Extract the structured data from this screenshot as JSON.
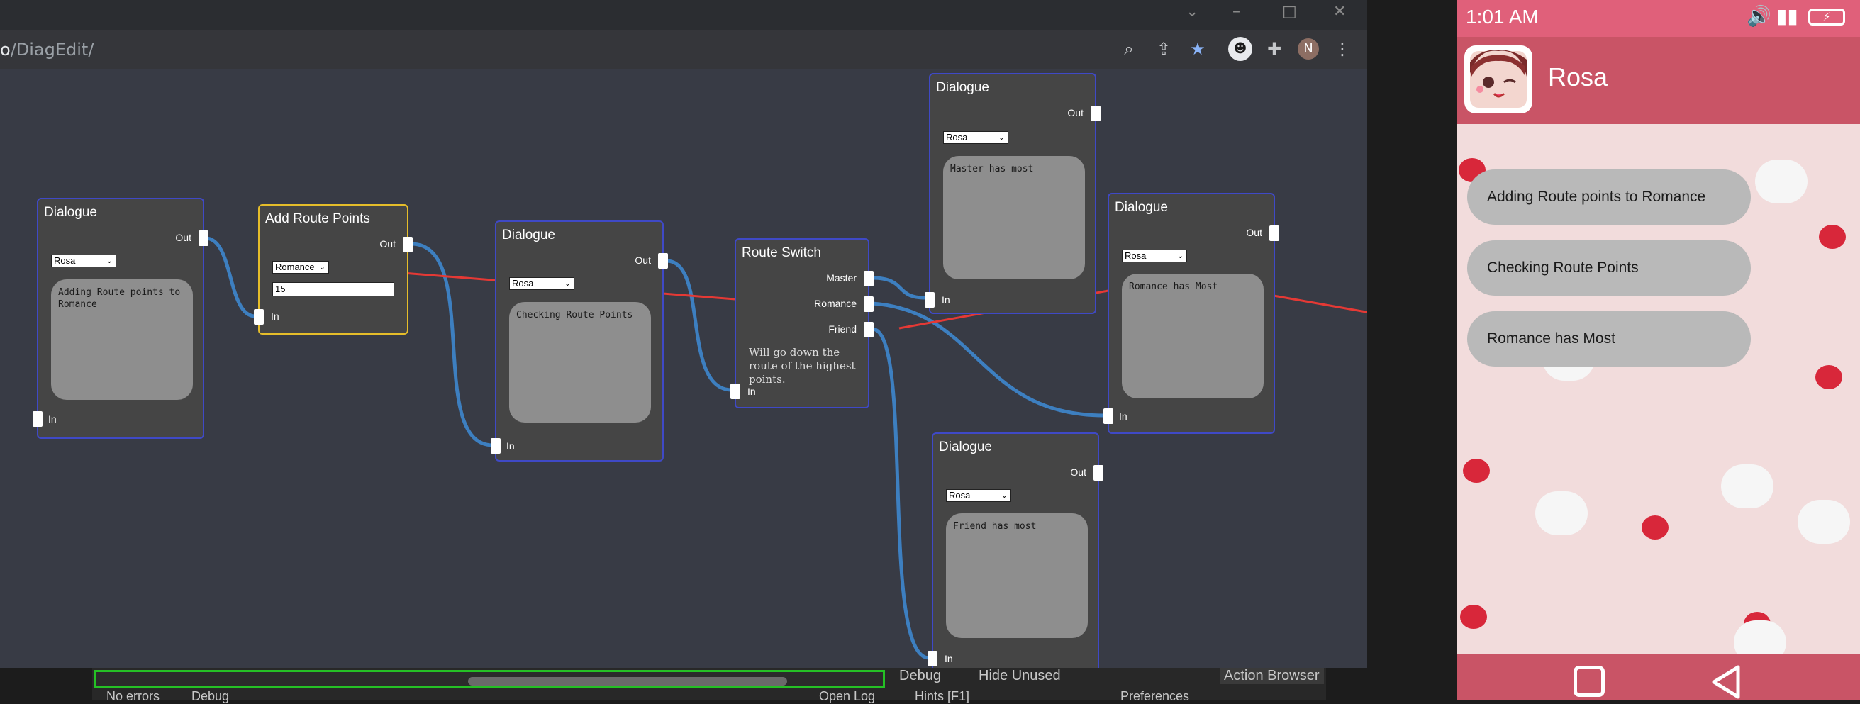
{
  "browser": {
    "url_prefix": "o",
    "url_path": "/DiagEdit/"
  },
  "graph": {
    "nodes": {
      "dialogue1": {
        "title": "Dialogue",
        "out": "Out",
        "in": "In",
        "speaker": "Rosa",
        "text": "Adding Route points to Romance"
      },
      "route_points": {
        "title": "Add Route Points",
        "out": "Out",
        "in": "In",
        "route": "Romance",
        "points": "15"
      },
      "dialogue2": {
        "title": "Dialogue",
        "out": "Out",
        "in": "In",
        "speaker": "Rosa",
        "text": "Checking Route Points"
      },
      "route_switch": {
        "title": "Route Switch",
        "master": "Master",
        "romance": "Romance",
        "friend": "Friend",
        "in": "In",
        "note": "Will go down the route of the highest points."
      },
      "dialogue_master": {
        "title": "Dialogue",
        "out": "Out",
        "in": "In",
        "speaker": "Rosa",
        "text": "Master has most"
      },
      "dialogue_romance": {
        "title": "Dialogue",
        "out": "Out",
        "in": "In",
        "speaker": "Rosa",
        "text": "Romance has Most"
      },
      "dialogue_friend": {
        "title": "Dialogue",
        "out": "Out",
        "in": "In",
        "speaker": "Rosa",
        "text": "Friend has most"
      }
    }
  },
  "unity": {
    "debug": "Debug",
    "hide_unused": "Hide Unused",
    "action_browser": "Action Browser",
    "no_errors": "No errors",
    "debug_dropdown": "Debug",
    "open_log": "Open Log",
    "hints": "Hints [F1]",
    "preferences": "Preferences"
  },
  "phone": {
    "time": "1:01 AM",
    "contact_name": "Rosa",
    "messages": [
      "Adding Route points to Romance",
      "Checking Route Points",
      "Romance has Most"
    ]
  },
  "colors": {
    "node_border": "#3f49c6",
    "highlight_border": "#e5bd2a",
    "wire": "#3d7fc0",
    "annotation_arrow": "#e53935",
    "phone_header": "#c95466"
  },
  "icons": [
    "zoom-icon",
    "share-icon",
    "star-icon",
    "extension-icon",
    "profile-avatar-icon",
    "menu-icon",
    "volume-icon",
    "signal-icon",
    "battery-icon",
    "home-icon",
    "back-icon"
  ]
}
